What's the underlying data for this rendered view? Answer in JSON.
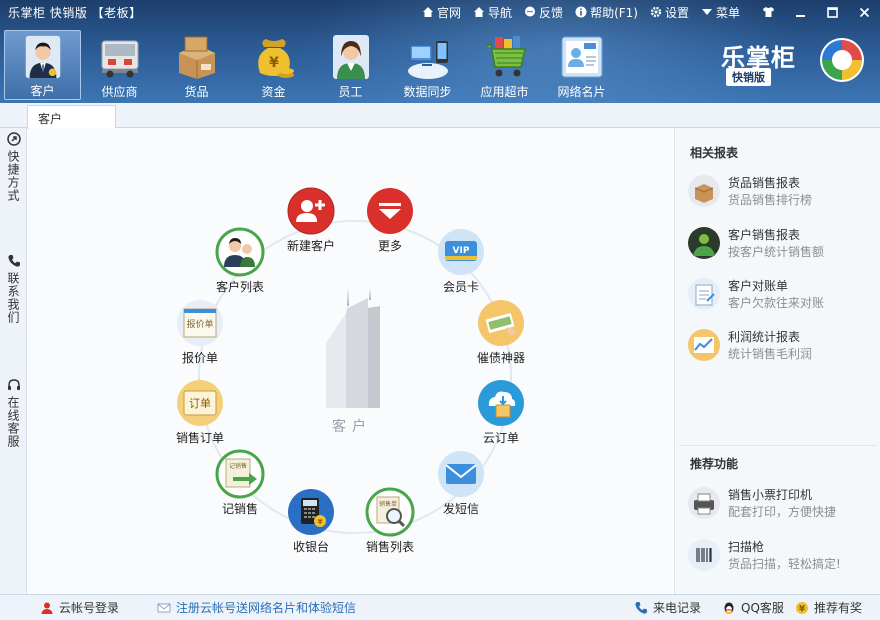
{
  "app": {
    "title": "乐掌柜 快销版 【老板】"
  },
  "topbar": {
    "links": [
      {
        "label": "官网",
        "icon": "home-icon"
      },
      {
        "label": "导航",
        "icon": "home-icon"
      },
      {
        "label": "反馈",
        "icon": "chat-icon"
      },
      {
        "label": "帮助(F1)",
        "icon": "info-icon"
      },
      {
        "label": "设置",
        "icon": "gear-icon"
      },
      {
        "label": "菜单",
        "icon": "dropdown-icon"
      }
    ],
    "window_buttons": [
      "shirt-skin-icon",
      "minimize-icon",
      "maximize-icon",
      "close-icon"
    ]
  },
  "nav": {
    "items": [
      {
        "label": "客户",
        "icon": "customer-icon",
        "active": true
      },
      {
        "label": "供应商",
        "icon": "supplier-truck-icon"
      },
      {
        "label": "货品",
        "icon": "goods-box-icon"
      },
      {
        "label": "资金",
        "icon": "money-bag-icon"
      },
      {
        "label": "员工",
        "icon": "employee-icon"
      },
      {
        "label": "数据同步",
        "icon": "data-sync-icon"
      },
      {
        "label": "应用超市",
        "icon": "app-market-cart-icon"
      },
      {
        "label": "网络名片",
        "icon": "business-card-icon"
      }
    ]
  },
  "logo": {
    "name": "乐掌柜",
    "edition": "快销版"
  },
  "tabs": [
    {
      "label": "客户"
    }
  ],
  "sidebar": {
    "items": [
      {
        "label": "快捷方式",
        "icon": "shortcut-icon"
      },
      {
        "label": "联系我们",
        "icon": "phone-icon"
      },
      {
        "label": "在线客服",
        "icon": "headset-icon"
      }
    ]
  },
  "main": {
    "center_label": "客户",
    "items": [
      {
        "label": "新建客户",
        "icon": "add-customer-icon"
      },
      {
        "label": "更多",
        "icon": "more-icon"
      },
      {
        "label": "会员卡",
        "icon": "vip-card-icon"
      },
      {
        "label": "催债神器",
        "icon": "debt-collect-icon"
      },
      {
        "label": "云订单",
        "icon": "cloud-order-icon"
      },
      {
        "label": "发短信",
        "icon": "sms-envelope-icon"
      },
      {
        "label": "销售列表",
        "icon": "sales-list-icon"
      },
      {
        "label": "收银台",
        "icon": "cash-register-icon"
      },
      {
        "label": "记销售",
        "icon": "record-sale-icon"
      },
      {
        "label": "销售订单",
        "icon": "sales-order-icon"
      },
      {
        "label": "报价单",
        "icon": "quotation-icon"
      },
      {
        "label": "客户列表",
        "icon": "customer-list-icon"
      }
    ]
  },
  "right_panel": {
    "reports_title": "相关报表",
    "reports": [
      {
        "title": "货品销售报表",
        "desc": "货品销售排行榜",
        "icon": "goods-report-icon"
      },
      {
        "title": "客户销售报表",
        "desc": "按客户统计销售额",
        "icon": "customer-report-icon"
      },
      {
        "title": "客户对账单",
        "desc": "客户欠款往来对账",
        "icon": "statement-icon"
      },
      {
        "title": "利润统计报表",
        "desc": "统计销售毛利润",
        "icon": "profit-chart-icon"
      }
    ],
    "recommend_title": "推荐功能",
    "recommend": [
      {
        "title": "销售小票打印机",
        "desc": "配套打印，方便快捷",
        "icon": "printer-icon"
      },
      {
        "title": "扫描枪",
        "desc": "货品扫描，轻松搞定!",
        "icon": "barcode-scanner-icon"
      }
    ]
  },
  "footer": {
    "cloud_login": "云帐号登录",
    "register_promo": "注册云帐号送网络名片和体验短信",
    "call_log": "来电记录",
    "qq_service": "QQ客服",
    "referral": "推荐有奖"
  },
  "colors": {
    "header_top": "#1d3e6b",
    "header_bottom": "#3c76b4",
    "red_button": "#d9302b",
    "link_blue": "#2a6fb8"
  }
}
